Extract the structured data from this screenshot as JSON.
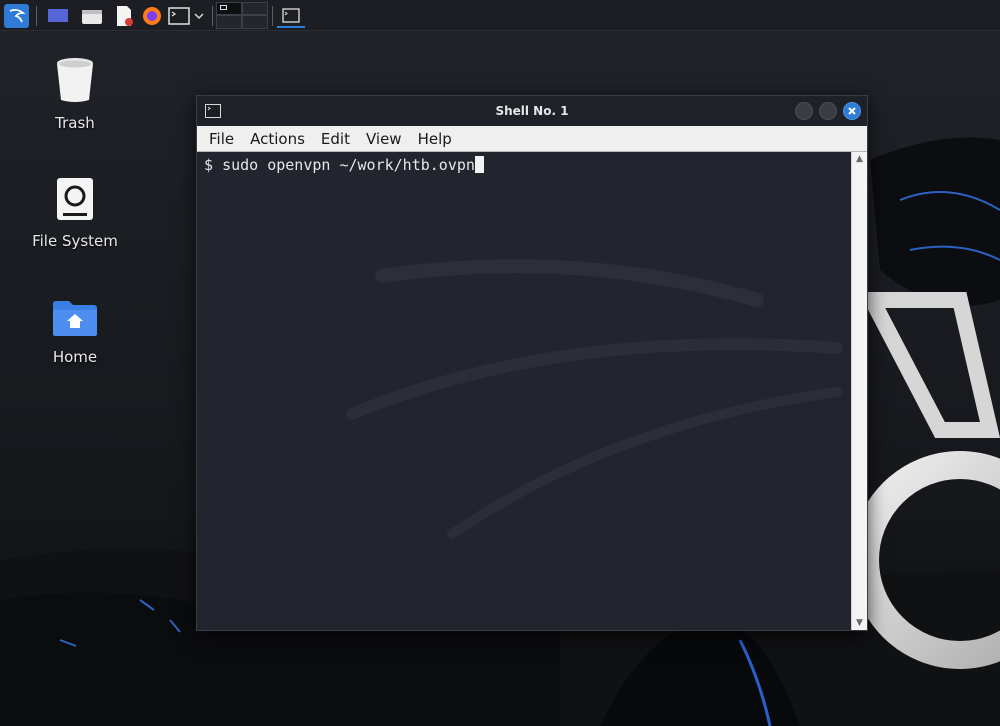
{
  "panel": {
    "icons": [
      "kali-menu-icon",
      "show-desktop-icon",
      "file-manager-icon",
      "text-editor-icon",
      "firefox-icon",
      "terminal-icon",
      "terminal-dropdown-icon"
    ],
    "taskbar_task": "terminal-task-icon"
  },
  "desktop": {
    "icons": [
      {
        "label": "Trash",
        "icon": "trash-icon"
      },
      {
        "label": "File System",
        "icon": "drive-icon"
      },
      {
        "label": "Home",
        "icon": "home-folder-icon"
      }
    ]
  },
  "window": {
    "title": "Shell No. 1",
    "menu": [
      "File",
      "Actions",
      "Edit",
      "View",
      "Help"
    ],
    "terminal": {
      "prompt": "$ ",
      "command": "sudo openvpn ~/work/htb.ovpn"
    }
  },
  "colors": {
    "accent": "#2f7bd8",
    "terminal_bg": "#23252e",
    "menubar_bg": "#efefef"
  }
}
